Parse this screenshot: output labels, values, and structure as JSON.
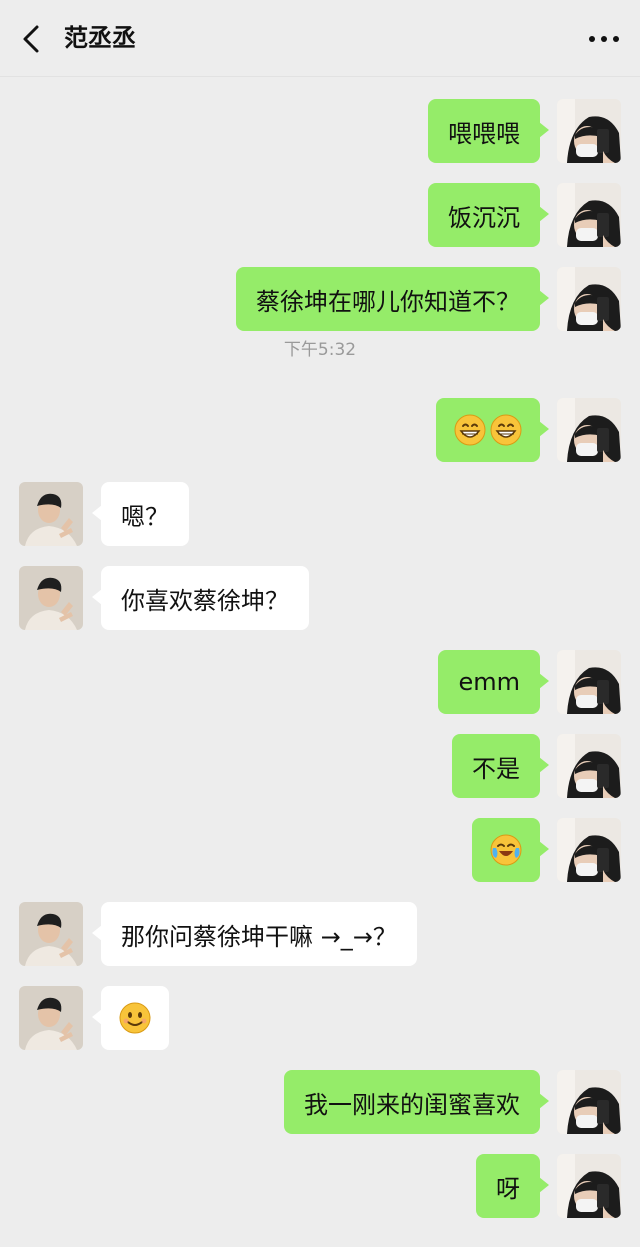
{
  "header": {
    "title": "范丞丞",
    "back_icon": "chevron-left-icon",
    "more_icon": "more-dots-icon"
  },
  "messages": [
    {
      "type": "msg",
      "sender": "me",
      "text": "喂喂喂"
    },
    {
      "type": "msg",
      "sender": "me",
      "text": "饭沉沉"
    },
    {
      "type": "msg",
      "sender": "me",
      "text": "蔡徐坤在哪儿你知道不？"
    },
    {
      "type": "time",
      "text": "下午5:32"
    },
    {
      "type": "emoji",
      "sender": "me",
      "emojis": [
        "grin-emoji",
        "grin-emoji"
      ]
    },
    {
      "type": "msg",
      "sender": "other",
      "text": "嗯？"
    },
    {
      "type": "msg",
      "sender": "other",
      "text": "你喜欢蔡徐坤？"
    },
    {
      "type": "msg",
      "sender": "me",
      "text": "emm"
    },
    {
      "type": "msg",
      "sender": "me",
      "text": "不是"
    },
    {
      "type": "emoji",
      "sender": "me",
      "emojis": [
        "laugh-cry-emoji"
      ]
    },
    {
      "type": "msg",
      "sender": "other",
      "text": "那你问蔡徐坤干嘛 →_→？"
    },
    {
      "type": "emoji",
      "sender": "other",
      "emojis": [
        "smile-emoji"
      ]
    },
    {
      "type": "msg",
      "sender": "me",
      "text": "我一刚来的闺蜜喜欢"
    },
    {
      "type": "msg",
      "sender": "me",
      "text": "呀"
    }
  ],
  "colors": {
    "background": "#ededed",
    "my_bubble": "#95ec69",
    "other_bubble": "#ffffff"
  }
}
